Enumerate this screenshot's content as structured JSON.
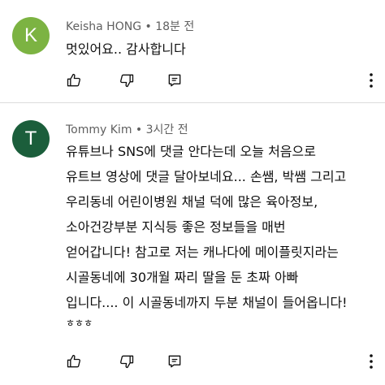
{
  "comments": [
    {
      "avatar_letter": "K",
      "avatar_color": "#7cb342",
      "author": "Keisha HONG",
      "separator": "•",
      "time": "18분 전",
      "lines": [
        "멋있어요.. 감사합니다"
      ]
    },
    {
      "avatar_letter": "T",
      "avatar_color": "#1b5e3b",
      "author": "Tommy Kim",
      "separator": "•",
      "time": "3시간 전",
      "lines": [
        "유튜브나 SNS에 댓글 안다는데 오늘 처음으로",
        "유트브 영상에 댓글 달아보네요... 손쌤, 박쌤 그리고",
        "우리동네 어린이병원 채널 덕에 많은 육아정보,",
        "소아건강부분 지식등 좋은 정보들을 매번",
        "얻어갑니다! 참고로 저는 캐나다에 메이플릿지라는",
        "시골동네에 30개월 짜리 딸을 둔 초짜 아빠",
        "입니다.... 이 시골동네까지 두분 채널이 들어옵니다!",
        "ㅎㅎㅎ"
      ]
    }
  ],
  "icons": {
    "like": "thumbs-up-icon",
    "dislike": "thumbs-down-icon",
    "reply": "reply-comment-icon",
    "more": "more-vertical-icon"
  }
}
